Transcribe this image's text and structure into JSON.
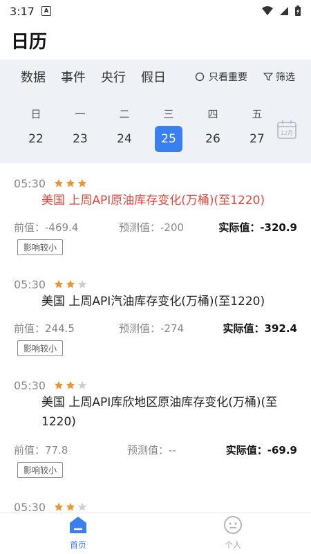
{
  "status": {
    "time": "3:17",
    "notif_badge": "A"
  },
  "app": {
    "title": "日历"
  },
  "tabs": [
    {
      "label": "数据",
      "active": true
    },
    {
      "label": "事件",
      "active": false
    },
    {
      "label": "央行",
      "active": false
    },
    {
      "label": "假日",
      "active": false
    }
  ],
  "filters": {
    "important_only": "只看重要",
    "filter": "筛选"
  },
  "calendar": {
    "weekdays": [
      "日",
      "一",
      "二",
      "三",
      "四",
      "五"
    ],
    "days": [
      "22",
      "23",
      "24",
      "25",
      "26",
      "27"
    ],
    "selected_day": "25",
    "month_icon_label": "12月"
  },
  "events": [
    {
      "time": "05:30",
      "stars": 3,
      "title": "美国 上周API原油库存变化(万桶)(至1220)",
      "highlight": true,
      "previous": "前值：-469.4",
      "forecast": "预测值：-200",
      "actual": "实际值：-320.9",
      "impact": "影响较小"
    },
    {
      "time": "05:30",
      "stars": 2,
      "title": "美国 上周API汽油库存变化(万桶)(至1220)",
      "highlight": false,
      "previous": "前值：244.5",
      "forecast": "预测值：-274",
      "actual": "实际值：392.4",
      "impact": "影响较小"
    },
    {
      "time": "05:30",
      "stars": 2,
      "title": "美国 上周API库欣地区原油库存变化(万桶)(至1220)",
      "highlight": false,
      "previous": "前值：77.8",
      "forecast": "预测值：--",
      "actual": "实际值：-69.9",
      "impact": "影响较小"
    },
    {
      "time": "05:30",
      "stars": 2
    }
  ],
  "bottom_nav": [
    {
      "label": "首页",
      "icon": "home-icon",
      "active": true
    },
    {
      "label": "个人",
      "icon": "person-icon",
      "active": false
    }
  ],
  "colors": {
    "accent": "#3a7ff0",
    "star_on": "#f0952e",
    "star_off": "#cfcfcf",
    "highlight_text": "#e2463a",
    "panel_bg": "#eef1f6"
  }
}
